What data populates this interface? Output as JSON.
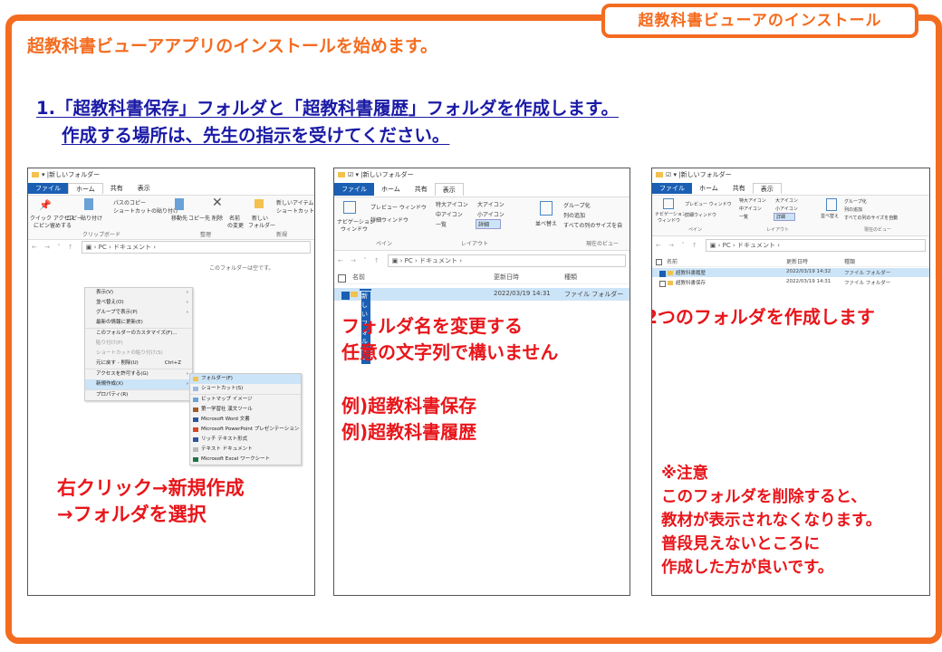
{
  "header": {
    "title_tab": "超教科書ビューアのインストール",
    "intro": "超教科書ビューアアプリのインストールを始めます。"
  },
  "step1": {
    "line1": "1.「超教科書保存」フォルダと「超教科書履歴」フォルダを作成します。",
    "line2": "作成する場所は、先生の指示を受けてください。"
  },
  "explorer_common": {
    "title": "新しいフォルダー",
    "tab_file": "ファイル",
    "tab_home": "ホーム",
    "tab_share": "共有",
    "tab_view": "表示",
    "addr_pc": "PC",
    "addr_docs": "ドキュメント",
    "col_name": "名前",
    "col_date": "更新日時",
    "col_type": "種類"
  },
  "panel1": {
    "ribbon": {
      "quick_access": "クイック アクセス",
      "pin": "にピン留めする",
      "copy": "コピー",
      "paste": "貼り付け",
      "path_copy": "パスのコピー",
      "shortcut_paste": "ショートカットの貼り付け",
      "clipboard": "クリップボード",
      "move_to": "移動先",
      "copy_to": "コピー先",
      "delete": "削除",
      "rename_1": "名前",
      "rename_2": "の変更",
      "organize": "整理",
      "new_folder_1": "新しい",
      "new_folder_2": "フォルダー",
      "new_item": "新しいアイテム",
      "shortcut": "ショートカット",
      "new_group": "新規"
    },
    "empty_msg": "このフォルダーは空です。",
    "context_menu": [
      {
        "label": "表示(V)",
        "arrow": "›",
        "shortcut": ""
      },
      {
        "label": "並べ替え(O)",
        "arrow": "›",
        "shortcut": ""
      },
      {
        "label": "グループで表示(P)",
        "arrow": "›",
        "shortcut": ""
      },
      {
        "label": "最新の情報に更新(E)",
        "arrow": "",
        "shortcut": ""
      },
      {
        "label": "このフォルダーのカスタマイズ(F)...",
        "arrow": "",
        "shortcut": ""
      },
      {
        "label": "貼り付け(P)",
        "arrow": "",
        "shortcut": ""
      },
      {
        "label": "ショートカットの貼り付け(S)",
        "arrow": "",
        "shortcut": ""
      },
      {
        "label": "元に戻す - 削除(U)",
        "arrow": "",
        "shortcut": "Ctrl+Z"
      },
      {
        "label": "アクセスを許可する(G)",
        "arrow": "›",
        "shortcut": ""
      },
      {
        "label": "新規作成(X)",
        "arrow": "›",
        "shortcut": ""
      },
      {
        "label": "プロパティ(R)",
        "arrow": "",
        "shortcut": ""
      }
    ],
    "submenu": [
      {
        "label": "フォルダー(F)",
        "icon": "folder-icon"
      },
      {
        "label": "ショートカット(S)",
        "icon": "shortcut-icon"
      },
      {
        "label": "ビットマップ イメージ",
        "icon": "bitmap-icon"
      },
      {
        "label": "第一学習社 漢文ツール",
        "icon": "app-icon"
      },
      {
        "label": "Microsoft Word 文書",
        "icon": "word-icon"
      },
      {
        "label": "Microsoft PowerPoint プレゼンテーション",
        "icon": "powerpoint-icon"
      },
      {
        "label": "リッチ テキスト形式",
        "icon": "rtf-icon"
      },
      {
        "label": "テキスト ドキュメント",
        "icon": "text-icon"
      },
      {
        "label": "Microsoft Excel ワークシート",
        "icon": "excel-icon"
      }
    ],
    "caption_line1": "右クリック→新規作成",
    "caption_line2": "→フォルダを選択"
  },
  "panel2": {
    "ribbon": {
      "preview": "プレビュー ウィンドウ",
      "details_pane": "詳細ウィンドウ",
      "nav_1": "ナビゲーション",
      "nav_2": "ウィンドウ",
      "pane": "ペイン",
      "xl_icon": "特大アイコン",
      "l_icon": "大アイコン",
      "m_icon": "中アイコン",
      "s_icon": "小アイコン",
      "list": "一覧",
      "details": "詳細",
      "layout": "レイアウト",
      "sort": "並べ替え",
      "group": "グループ化",
      "add_col": "列の追加",
      "fit_cols": "すべての列のサイズを自",
      "current_view": "現在のビュー"
    },
    "row_name": "新しいフォルダー",
    "row_date": "2022/03/19 14:31",
    "row_type": "ファイル フォルダー",
    "caption_line1": "フォルダ名を変更する",
    "caption_line2": "任意の文字列で構いません",
    "example1": "例)超教科書保存",
    "example2": "例)超教科書履歴"
  },
  "panel3": {
    "rows": [
      {
        "name": "超教科書履歴",
        "date": "2022/03/19 14:32",
        "type": "ファイル フォルダー",
        "selected": true
      },
      {
        "name": "超教科書保存",
        "date": "2022/03/19 14:31",
        "type": "ファイル フォルダー",
        "selected": false
      }
    ],
    "ribbon": {
      "fit_cols": "すべての列のサイズを自動"
    },
    "caption": "2つのフォルダを作成します",
    "note_title": "※注意",
    "note_l1": "このフォルダを削除すると、",
    "note_l2": "教材が表示されなくなります。",
    "note_l3": "普段見えないところに",
    "note_l4": "作成した方が良いです。"
  },
  "colors": {
    "accent": "#f36c20",
    "heading_blue": "#1a1aa6",
    "caption_red": "#e8161b",
    "selection": "#cce4f7",
    "ribbon_file": "#1a5fb4"
  }
}
